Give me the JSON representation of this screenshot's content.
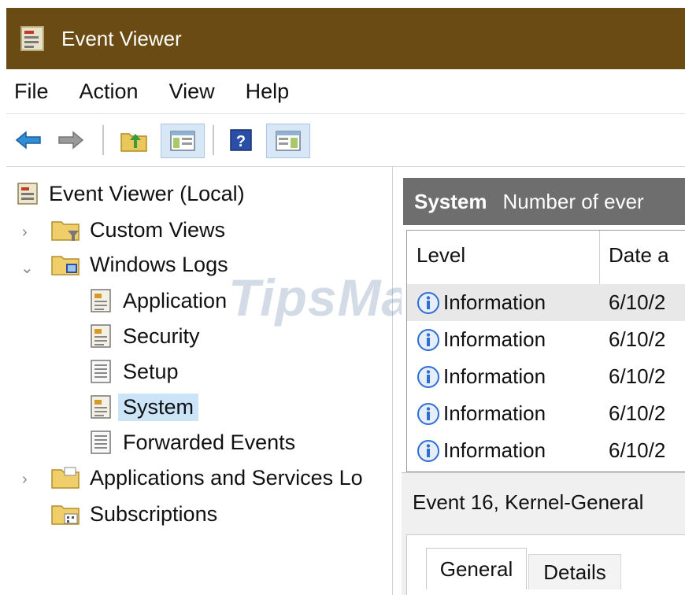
{
  "window": {
    "title": "Event Viewer"
  },
  "menu": {
    "items": [
      "File",
      "Action",
      "View",
      "Help"
    ]
  },
  "toolbar": {
    "buttons": [
      {
        "icon": "back-arrow-icon"
      },
      {
        "icon": "forward-arrow-icon"
      },
      {
        "icon": "folder-up-icon"
      },
      {
        "icon": "show-hide-tree-icon"
      },
      {
        "icon": "help-icon"
      },
      {
        "icon": "show-hide-action-pane-icon"
      }
    ]
  },
  "tree": {
    "root": "Event Viewer (Local)",
    "custom_views": "Custom Views",
    "windows_logs": "Windows Logs",
    "application": "Application",
    "security": "Security",
    "setup": "Setup",
    "system": "System",
    "forwarded_events": "Forwarded Events",
    "app_services": "Applications and Services Lo",
    "subscriptions": "Subscriptions",
    "selected": "System"
  },
  "log": {
    "name": "System",
    "count_label": "Number of ever",
    "columns": {
      "level": "Level",
      "date": "Date a"
    },
    "rows": [
      {
        "level": "Information",
        "date": "6/10/2"
      },
      {
        "level": "Information",
        "date": "6/10/2"
      },
      {
        "level": "Information",
        "date": "6/10/2"
      },
      {
        "level": "Information",
        "date": "6/10/2"
      },
      {
        "level": "Information",
        "date": "6/10/2"
      }
    ]
  },
  "detail": {
    "title": "Event 16, Kernel-General",
    "tabs": {
      "general": "General",
      "details": "Details"
    }
  },
  "watermark": "TipsMake",
  "colors": {
    "titlebar": "#6b4b14",
    "log_header": "#6e6e6e",
    "selection": "#cce4f7",
    "info_icon": "#2f6fd1"
  }
}
